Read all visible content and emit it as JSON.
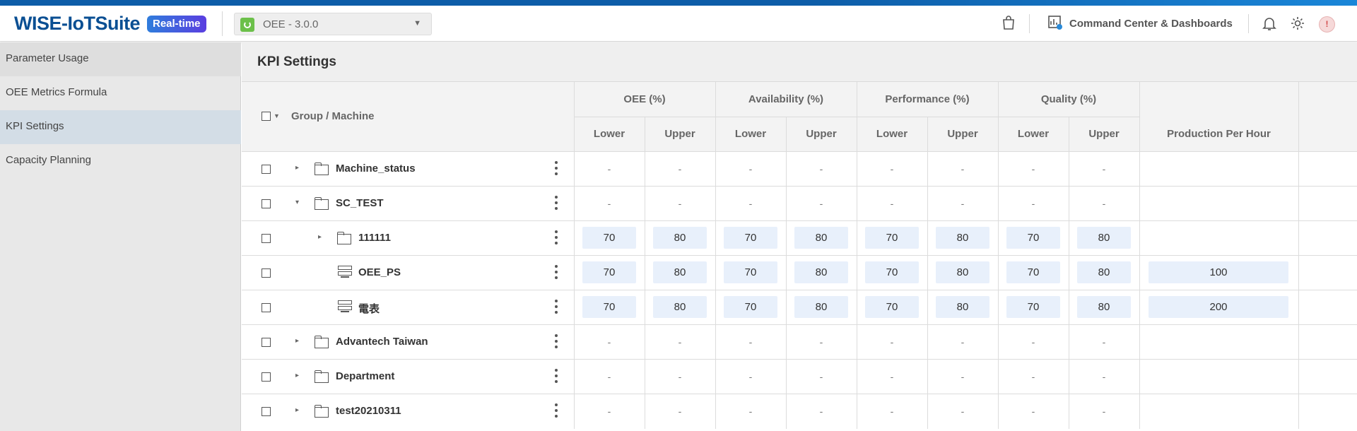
{
  "header": {
    "brand": "WISE-IoTSuite",
    "badge": "Real-time",
    "app_selector": {
      "value": "OEE - 3.0.0"
    },
    "command_center_label": "Command Center & Dashboards",
    "avatar_initial": "!"
  },
  "sidebar": {
    "items": [
      {
        "label": "Parameter Usage"
      },
      {
        "label": "OEE Metrics Formula"
      },
      {
        "label": "KPI Settings",
        "active": true
      },
      {
        "label": "Capacity Planning"
      }
    ]
  },
  "page": {
    "title": "KPI Settings"
  },
  "table": {
    "group_header": "Group / Machine",
    "groups": [
      {
        "label": "OEE (%)"
      },
      {
        "label": "Availability (%)"
      },
      {
        "label": "Performance (%)"
      },
      {
        "label": "Quality (%)"
      }
    ],
    "sub": {
      "lower": "Lower",
      "upper": "Upper"
    },
    "production_header": "Production Per Hour",
    "rows": [
      {
        "name": "Machine_status",
        "type": "folder",
        "expander": "▸",
        "values": [
          "-",
          "-",
          "-",
          "-",
          "-",
          "-",
          "-",
          "-"
        ],
        "production": ""
      },
      {
        "name": "SC_TEST",
        "type": "folder",
        "expander": "▾",
        "values": [
          "-",
          "-",
          "-",
          "-",
          "-",
          "-",
          "-",
          "-"
        ],
        "production": ""
      },
      {
        "name": "111111",
        "type": "folder",
        "expander": "▸",
        "values": [
          "70",
          "80",
          "70",
          "80",
          "70",
          "80",
          "70",
          "80"
        ],
        "production": ""
      },
      {
        "name": "OEE_PS",
        "type": "machine",
        "expander": "",
        "values": [
          "70",
          "80",
          "70",
          "80",
          "70",
          "80",
          "70",
          "80"
        ],
        "production": "100"
      },
      {
        "name": "電表",
        "type": "machine",
        "expander": "",
        "values": [
          "70",
          "80",
          "70",
          "80",
          "70",
          "80",
          "70",
          "80"
        ],
        "production": "200"
      },
      {
        "name": "Advantech Taiwan",
        "type": "folder",
        "expander": "▸",
        "values": [
          "-",
          "-",
          "-",
          "-",
          "-",
          "-",
          "-",
          "-"
        ],
        "production": ""
      },
      {
        "name": "Department",
        "type": "folder",
        "expander": "▸",
        "values": [
          "-",
          "-",
          "-",
          "-",
          "-",
          "-",
          "-",
          "-"
        ],
        "production": ""
      },
      {
        "name": "test20210311",
        "type": "folder",
        "expander": "▸",
        "values": [
          "-",
          "-",
          "-",
          "-",
          "-",
          "-",
          "-",
          "-"
        ],
        "production": ""
      }
    ]
  },
  "colors": {
    "brand": "#0a4f93",
    "badge_from": "#2f7ddc",
    "badge_to": "#5a3ee0",
    "value_bg": "#e8f0fb",
    "active_side": "#d3dde6"
  }
}
